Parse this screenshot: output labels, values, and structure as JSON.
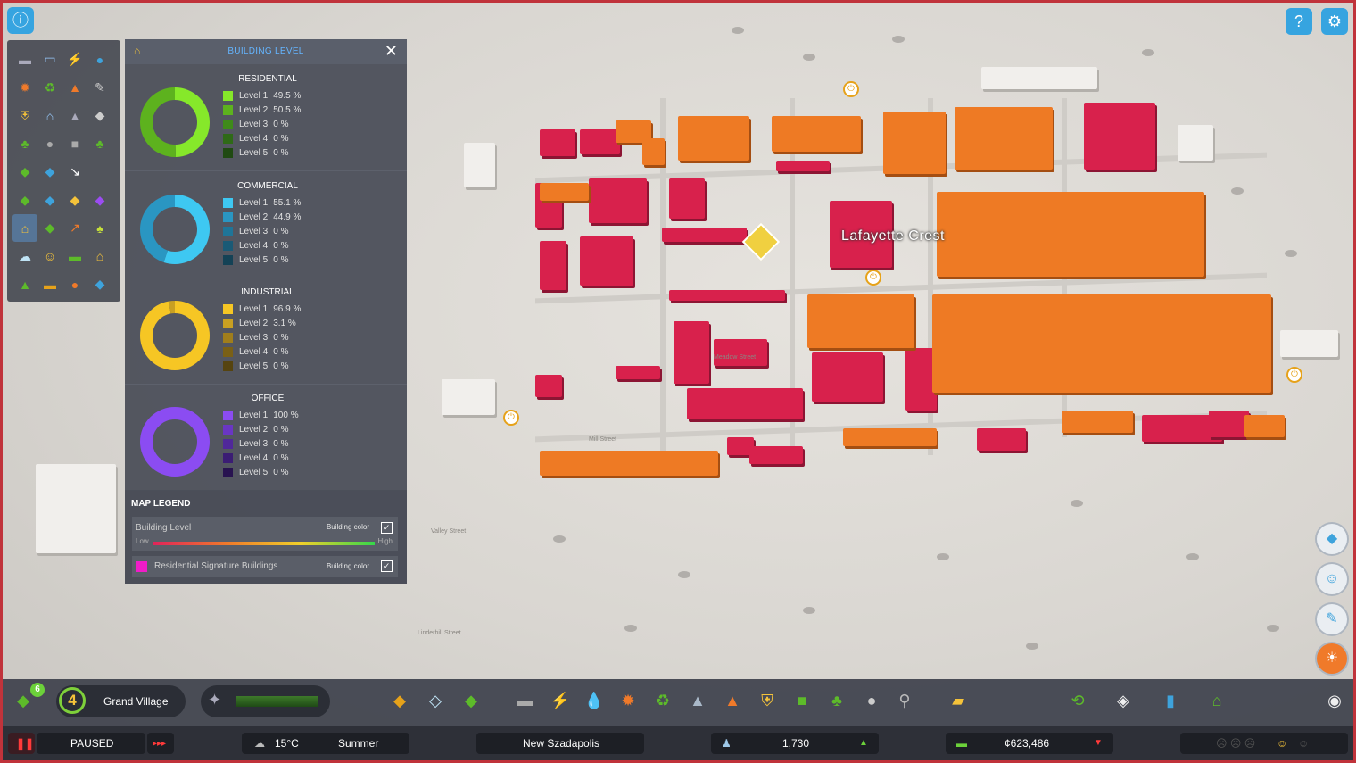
{
  "map": {
    "district_label": "Lafayette Crest",
    "streets": [
      "Valley Street",
      "Linderhill Street",
      "Mill Street",
      "Meadow Street"
    ]
  },
  "top": {
    "info_icon": "info-icon",
    "help_icon": "help-icon",
    "settings_icon": "gear-icon"
  },
  "palette": {
    "icons": [
      "road-icon",
      "bus-icon",
      "electricity-icon",
      "water-icon",
      "fire-icon",
      "recycle-icon",
      "disaster-icon",
      "wrench-icon",
      "police-icon",
      "bank-icon",
      "education-icon",
      "tourism-icon",
      "park-icon",
      "garbage-icon",
      "vehicle-icon",
      "landscape-icon",
      "wind-icon",
      "transport-icon",
      "arrow-icon",
      "",
      "zone-residential-icon",
      "zone-commercial-icon",
      "zone-industrial-icon",
      "zone-office-icon",
      "building-level-icon",
      "land-value-icon",
      "stats-icon",
      "plant-icon",
      "happiness-icon",
      "smile-icon",
      "money-icon",
      "house-icon",
      "pollution-icon",
      "cargo-icon",
      "traffic-icon",
      "terrain-icon"
    ]
  },
  "panel": {
    "title": "BUILDING LEVEL",
    "sections": [
      {
        "title": "RESIDENTIAL",
        "levels": [
          {
            "label": "Level 1",
            "value": "49.5 %",
            "pct": 49.5,
            "color": "#86e82a"
          },
          {
            "label": "Level 2",
            "value": "50.5 %",
            "pct": 50.5,
            "color": "#5db21e"
          },
          {
            "label": "Level 3",
            "value": "0 %",
            "pct": 0,
            "color": "#3f8a1a"
          },
          {
            "label": "Level 4",
            "value": "0 %",
            "pct": 0,
            "color": "#2f6a17"
          },
          {
            "label": "Level 5",
            "value": "0 %",
            "pct": 0,
            "color": "#204a12"
          }
        ]
      },
      {
        "title": "COMMERCIAL",
        "levels": [
          {
            "label": "Level 1",
            "value": "55.1 %",
            "pct": 55.1,
            "color": "#3ec8f2"
          },
          {
            "label": "Level 2",
            "value": "44.9 %",
            "pct": 44.9,
            "color": "#2a96c2"
          },
          {
            "label": "Level 3",
            "value": "0 %",
            "pct": 0,
            "color": "#1f7598"
          },
          {
            "label": "Level 4",
            "value": "0 %",
            "pct": 0,
            "color": "#1a5a76"
          },
          {
            "label": "Level 5",
            "value": "0 %",
            "pct": 0,
            "color": "#144256"
          }
        ]
      },
      {
        "title": "INDUSTRIAL",
        "levels": [
          {
            "label": "Level 1",
            "value": "96.9 %",
            "pct": 96.9,
            "color": "#f6c624"
          },
          {
            "label": "Level 2",
            "value": "3.1 %",
            "pct": 3.1,
            "color": "#c9a022"
          },
          {
            "label": "Level 3",
            "value": "0 %",
            "pct": 0,
            "color": "#a07e1c"
          },
          {
            "label": "Level 4",
            "value": "0 %",
            "pct": 0,
            "color": "#7a6016"
          },
          {
            "label": "Level 5",
            "value": "0 %",
            "pct": 0,
            "color": "#564410"
          }
        ]
      },
      {
        "title": "OFFICE",
        "levels": [
          {
            "label": "Level 1",
            "value": "100 %",
            "pct": 100,
            "color": "#8b4cf2"
          },
          {
            "label": "Level 2",
            "value": "0 %",
            "pct": 0,
            "color": "#6a36c4"
          },
          {
            "label": "Level 3",
            "value": "0 %",
            "pct": 0,
            "color": "#50289a"
          },
          {
            "label": "Level 4",
            "value": "0 %",
            "pct": 0,
            "color": "#3b1d74"
          },
          {
            "label": "Level 5",
            "value": "0 %",
            "pct": 0,
            "color": "#281350"
          }
        ]
      }
    ],
    "legend": {
      "title": "MAP LEGEND",
      "row1": {
        "name": "Building Level",
        "building_color": "Building color",
        "low": "Low",
        "high": "High"
      },
      "row2": {
        "name": "Residential Signature Buildings",
        "building_color": "Building color",
        "swatch": "#f01cc8"
      }
    }
  },
  "toolbar": {
    "milestone_badge": "6",
    "city_level": "4",
    "city_name": "Grand Village"
  },
  "status": {
    "paused": "PAUSED",
    "temperature": "15°C",
    "season": "Summer",
    "city": "New Szadapolis",
    "population": "1,730",
    "money": "¢623,486"
  }
}
